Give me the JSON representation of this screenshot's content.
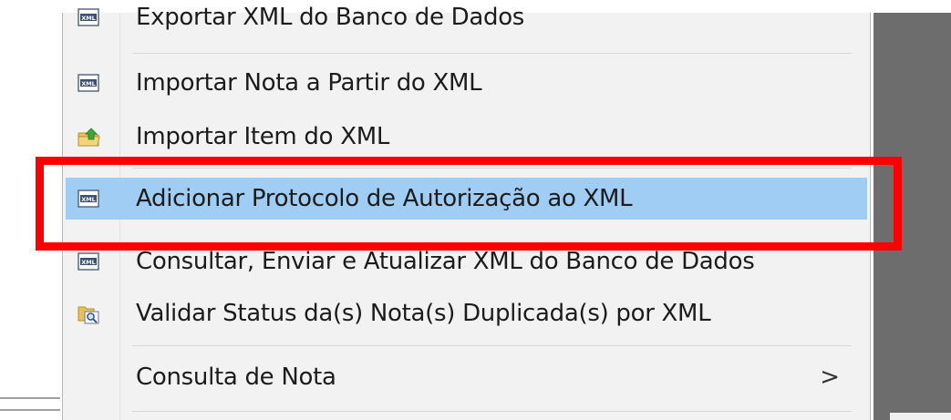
{
  "menu": {
    "items": [
      {
        "label": "Exportar XML do Banco de Dados",
        "icon": "xml-file-icon",
        "partial": true
      },
      {
        "label": "Importar Nota a Partir do XML",
        "icon": "xml-file-icon"
      },
      {
        "label": "Importar Item do XML",
        "icon": "folder-import-icon"
      },
      {
        "label": "Adicionar Protocolo de Autorização ao XML",
        "icon": "xml-file-icon",
        "highlighted": true
      },
      {
        "label": "Consultar, Enviar e Atualizar XML do Banco de Dados",
        "icon": "xml-file-icon"
      },
      {
        "label": "Validar Status da(s) Nota(s) Duplicada(s) por XML",
        "icon": "folder-search-icon"
      },
      {
        "label": "Consulta de Nota",
        "submenu_arrow": ">"
      }
    ]
  },
  "colors": {
    "highlight": "#9fcdf4",
    "annotation": "#ff0000",
    "menu_background": "#f2f2f2"
  }
}
